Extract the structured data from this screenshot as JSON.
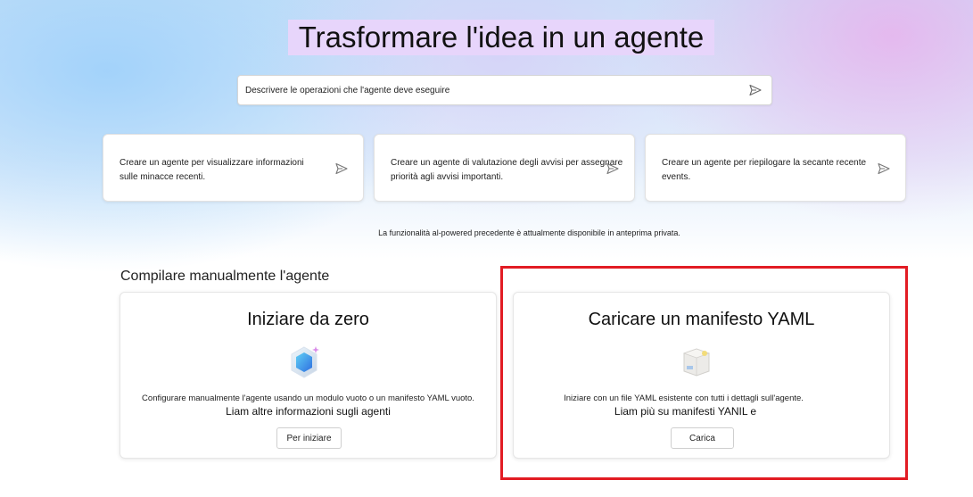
{
  "header": {
    "title": "Trasformare l'idea in un agente"
  },
  "prompt": {
    "placeholder": "Descrivere le operazioni che l'agente deve eseguire",
    "value": ""
  },
  "suggestions": [
    {
      "text": "Creare un agente per visualizzare informazioni sulle minacce recenti."
    },
    {
      "text": "Creare un agente di valutazione degli avvisi per assegnare priorità agli avvisi importanti."
    },
    {
      "text": "Creare un agente per riepilogare la secante recente events."
    }
  ],
  "notice": "La funzionalità al-powered precedente è attualmente disponibile in anteprima privata.",
  "manual": {
    "section_title": "Compilare manualmente l'agente",
    "scratch": {
      "title": "Iniziare da zero",
      "description": "Configurare manualmente l'agente usando un modulo vuoto o un manifesto YAML vuoto.",
      "link": "Liam altre informazioni sugli agenti",
      "button": "Per iniziare",
      "icon": "agent-hexagon-icon"
    },
    "yaml": {
      "title": "Caricare un manifesto YAML",
      "description": "Iniziare con un file YAML esistente con tutti i dettagli sull'agente.",
      "link": "Liam più su manifesti YANIL e",
      "button": "Carica",
      "icon": "package-box-icon"
    }
  },
  "colors": {
    "highlight": "#e21c24",
    "title_bg": "#e7d5fb"
  }
}
